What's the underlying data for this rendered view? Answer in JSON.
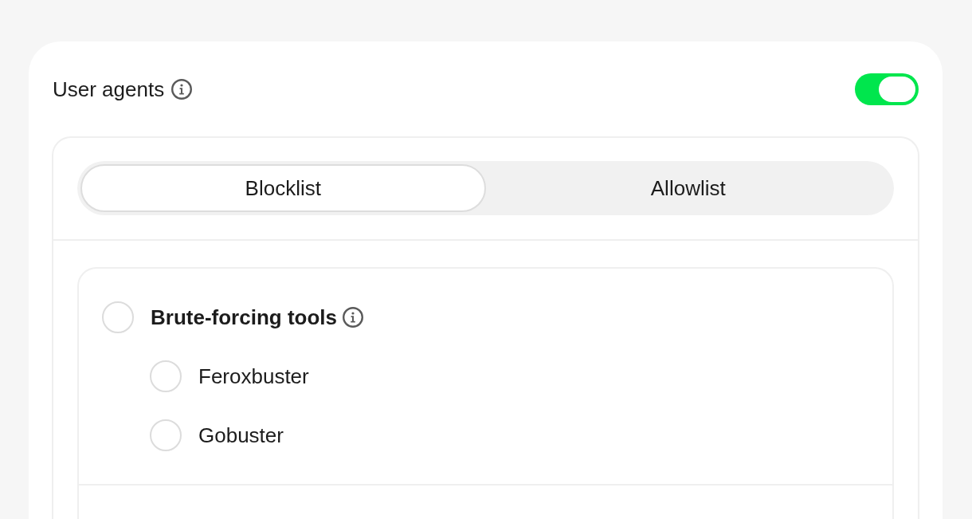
{
  "section": {
    "title": "User agents",
    "enabled": true
  },
  "tabs": [
    {
      "label": "Blocklist",
      "selected": true
    },
    {
      "label": "Allowlist",
      "selected": false
    }
  ],
  "groups": [
    {
      "label": "Brute-forcing tools",
      "checked": false,
      "children": [
        {
          "label": "Feroxbuster",
          "checked": false
        },
        {
          "label": "Gobuster",
          "checked": false
        }
      ]
    }
  ]
}
